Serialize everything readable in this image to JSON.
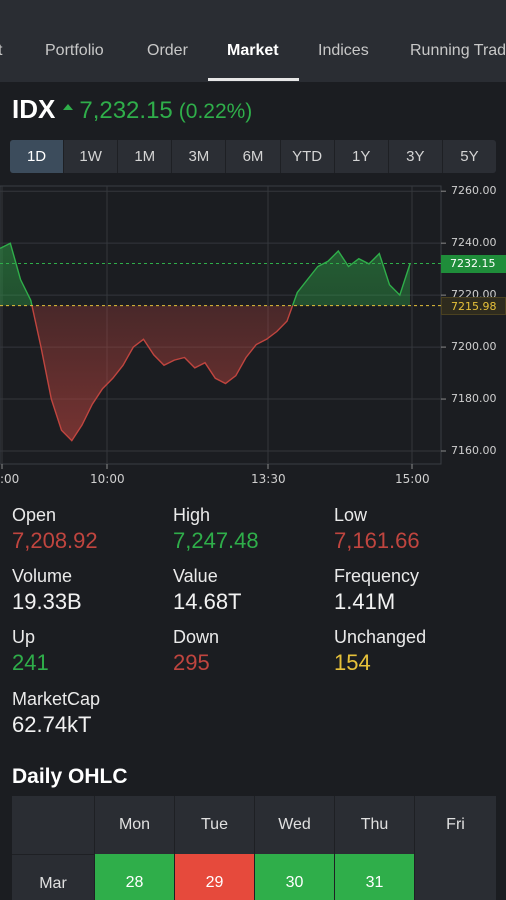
{
  "nav": {
    "tabs": [
      {
        "label": "t"
      },
      {
        "label": "Portfolio"
      },
      {
        "label": "Order"
      },
      {
        "label": "Market"
      },
      {
        "label": "Indices"
      },
      {
        "label": "Running Trad"
      }
    ],
    "active_tab": "Market"
  },
  "index": {
    "name": "IDX",
    "value": "7,232.15",
    "change": "(0.22%)",
    "direction_icon": "triangle-up-icon"
  },
  "ranges": [
    "1D",
    "1W",
    "1M",
    "3M",
    "6M",
    "YTD",
    "1Y",
    "3Y",
    "5Y"
  ],
  "active_range": "1D",
  "chart_data": {
    "type": "area",
    "y_ticks": [
      "7260.00",
      "7240.00",
      "7220.00",
      "7200.00",
      "7180.00",
      "7160.00"
    ],
    "x_ticks": [
      ":00",
      "10:00",
      "13:30",
      "15:00"
    ],
    "ylim": [
      7155,
      7262
    ],
    "last_value": 7232.15,
    "last_value_label": "7232.15",
    "prev_close": 7215.98,
    "prev_close_label": "7215.98",
    "series": [
      {
        "values": [
          7238,
          7240,
          7226,
          7218,
          7200,
          7180,
          7168,
          7164,
          7170,
          7178,
          7184,
          7188,
          7193,
          7200,
          7203,
          7197,
          7193,
          7195,
          7196,
          7192,
          7194,
          7188,
          7186,
          7189,
          7196,
          7201,
          7203,
          7206,
          7210,
          7221,
          7226,
          7231,
          7233,
          7237,
          7231,
          7234,
          7232,
          7236,
          7224,
          7220,
          7232
        ]
      }
    ],
    "colors": {
      "up": "#2fae4a",
      "down": "#c0453f",
      "prev_close": "#e6c13a"
    }
  },
  "stats": {
    "open": {
      "label": "Open",
      "value": "7,208.92"
    },
    "high": {
      "label": "High",
      "value": "7,247.48"
    },
    "low": {
      "label": "Low",
      "value": "7,161.66"
    },
    "volume": {
      "label": "Volume",
      "value": "19.33B"
    },
    "value": {
      "label": "Value",
      "value": "14.68T"
    },
    "frequency": {
      "label": "Frequency",
      "value": "1.41M"
    },
    "up": {
      "label": "Up",
      "value": "241"
    },
    "down": {
      "label": "Down",
      "value": "295"
    },
    "unchanged": {
      "label": "Unchanged",
      "value": "154"
    },
    "marketcap": {
      "label": "MarketCap",
      "value": "62.74kT"
    }
  },
  "ohlc": {
    "title": "Daily OHLC",
    "days": [
      "Mon",
      "Tue",
      "Wed",
      "Thu",
      "Fri"
    ],
    "month": "Mar",
    "dates": [
      {
        "day": "28",
        "color": "#2fae4a"
      },
      {
        "day": "29",
        "color": "#e64a3c"
      },
      {
        "day": "30",
        "color": "#2fae4a"
      },
      {
        "day": "31",
        "color": "#2fae4a"
      },
      {
        "day": "",
        "color": "#2a2d33"
      }
    ]
  }
}
